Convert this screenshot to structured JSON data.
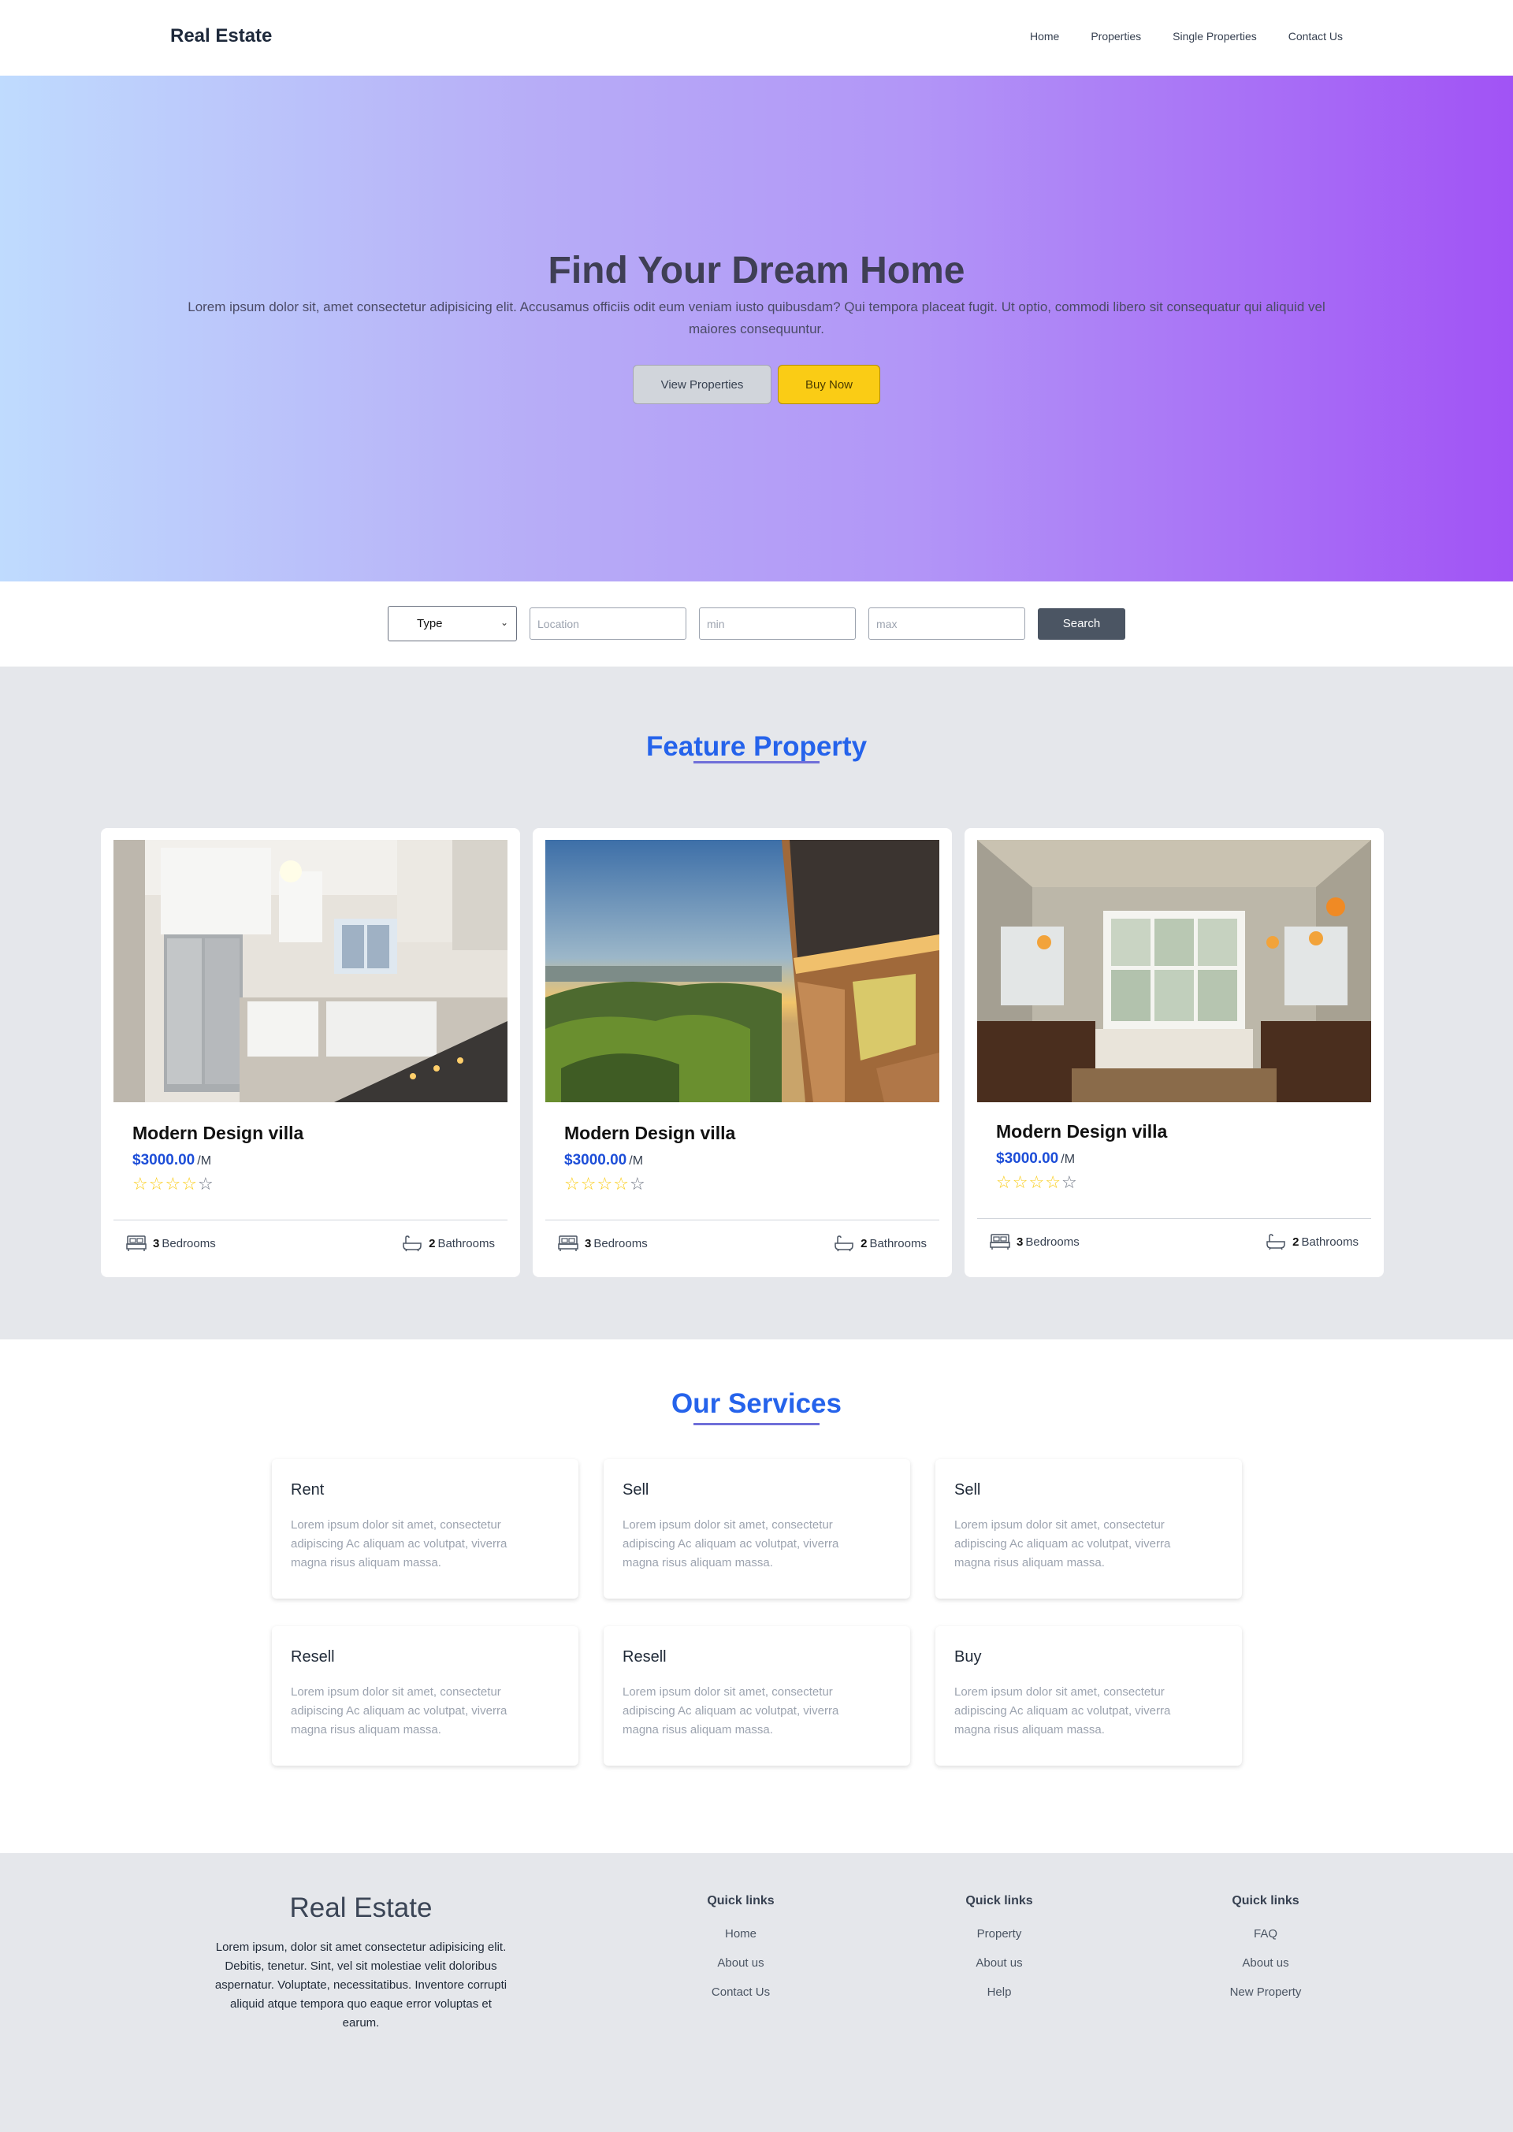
{
  "nav": {
    "brand": "Real Estate",
    "links": [
      "Home",
      "Properties",
      "Single Properties",
      "Contact Us"
    ]
  },
  "hero": {
    "title": "Find Your Dream Home",
    "subtitle": "Lorem ipsum dolor sit, amet consectetur adipisicing elit. Accusamus officiis odit eum veniam iusto quibusdam? Qui tempora placeat fugit. Ut optio, commodi libero sit consequatur qui aliquid vel maiores consequuntur.",
    "view_button": "View Properties",
    "buy_button": "Buy Now"
  },
  "search": {
    "type_value": "Type",
    "location_placeholder": "Location",
    "min_placeholder": "min",
    "max_placeholder": "max",
    "button": "Search"
  },
  "feature": {
    "title": "Feature Property",
    "cards": [
      {
        "name": "Modern Design villa",
        "price": "$3000.00",
        "per": "/M",
        "rating": 4,
        "bedrooms": "3",
        "bedrooms_label": "Bedrooms",
        "bathrooms": "2",
        "bathrooms_label": "Bathrooms",
        "photo_icon": "kitchen-photo"
      },
      {
        "name": "Modern Design villa",
        "price": "$3000.00",
        "per": "/M",
        "rating": 4,
        "bedrooms": "3",
        "bedrooms_label": "Bedrooms",
        "bathrooms": "2",
        "bathrooms_label": "Bathrooms",
        "photo_icon": "balcony-sunset-photo"
      },
      {
        "name": "Modern Design villa",
        "price": "$3000.00",
        "per": "/M",
        "rating": 4,
        "bedrooms": "3",
        "bedrooms_label": "Bedrooms",
        "bathrooms": "2",
        "bathrooms_label": "Bathrooms",
        "photo_icon": "bathroom-photo"
      }
    ]
  },
  "services": {
    "title": "Our Services",
    "items": [
      {
        "title": "Rent",
        "desc": "Lorem ipsum dolor sit amet, consectetur adipiscing Ac aliquam ac volutpat, viverra magna risus aliquam massa."
      },
      {
        "title": "Sell",
        "desc": "Lorem ipsum dolor sit amet, consectetur adipiscing Ac aliquam ac volutpat, viverra magna risus aliquam massa."
      },
      {
        "title": "Sell",
        "desc": "Lorem ipsum dolor sit amet, consectetur adipiscing Ac aliquam ac volutpat, viverra magna risus aliquam massa."
      },
      {
        "title": "Resell",
        "desc": "Lorem ipsum dolor sit amet, consectetur adipiscing Ac aliquam ac volutpat, viverra magna risus aliquam massa."
      },
      {
        "title": "Resell",
        "desc": "Lorem ipsum dolor sit amet, consectetur adipiscing Ac aliquam ac volutpat, viverra magna risus aliquam massa."
      },
      {
        "title": "Buy",
        "desc": "Lorem ipsum dolor sit amet, consectetur adipiscing Ac aliquam ac volutpat, viverra magna risus aliquam massa."
      }
    ]
  },
  "footer": {
    "brand": "Real Estate",
    "desc": "Lorem ipsum, dolor sit amet consectetur adipisicing elit. Debitis, tenetur. Sint, vel sit molestiae velit doloribus aspernatur. Voluptate, necessitatibus. Inventore corrupti aliquid atque tempora quo eaque error voluptas et earum.",
    "cols": [
      {
        "heading": "Quick links",
        "links": [
          "Home",
          "About us",
          "Contact Us"
        ]
      },
      {
        "heading": "Quick links",
        "links": [
          "Property",
          "About us",
          "Help"
        ]
      },
      {
        "heading": "Quick links",
        "links": [
          "FAQ",
          "About us",
          "New Property"
        ]
      }
    ]
  },
  "colors": {
    "accent": "#2563eb",
    "price": "#1d4ed8",
    "buy_button": "#facc15",
    "search_button": "#4b5563",
    "star": "#facc15"
  }
}
